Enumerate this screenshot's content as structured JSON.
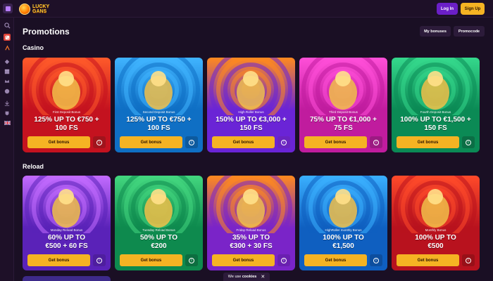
{
  "header": {
    "logo_text": "LUCKY GANS",
    "login_label": "Log In",
    "signup_label": "Sign Up"
  },
  "sidebar": {
    "icons": [
      "search-icon",
      "casino-icon",
      "sports-icon",
      "cards-icon",
      "promo-icon",
      "vip-icon",
      "gift-icon",
      "download-icon",
      "support-icon",
      "language-flag-icon"
    ]
  },
  "page": {
    "title": "Promotions",
    "my_bonuses_label": "My bonuses",
    "promocode_label": "Promocode"
  },
  "sections": {
    "casino": {
      "title": "Casino",
      "cards": [
        {
          "label": "First Deposit Bonus",
          "line1": "125% UP TO €750 +",
          "line2": "100 FS",
          "button": "Get bonus",
          "bg": "#c4121f",
          "bg2": "#ff5a2a",
          "info": "#a0141c"
        },
        {
          "label": "Second Deposit Bonus",
          "line1": "125% UP TO €750 +",
          "line2": "100 FS",
          "button": "Get bonus",
          "bg": "#0f6fc4",
          "bg2": "#40b4ff",
          "info": "#0d5a9e"
        },
        {
          "label": "High Roller Bonus",
          "line1": "150% UP TO €3,000 +",
          "line2": "150 FS",
          "button": "Get bonus",
          "bg": "#6a24d6",
          "bg2": "#ff8a1e",
          "info": "#6a24c0"
        },
        {
          "label": "Third Deposit Bonus",
          "line1": "75% UP TO €1,000 +",
          "line2": "75 FS",
          "button": "Get bonus",
          "bg": "#c01c9e",
          "bg2": "#ff4fd8",
          "info": "#9c1a82"
        },
        {
          "label": "Fourth Deposit Bonus",
          "line1": "100% UP TO €1,500 +",
          "line2": "150 FS",
          "button": "Get bonus",
          "bg": "#0b8a55",
          "bg2": "#35d88c",
          "info": "#0b6e45"
        }
      ]
    },
    "reload": {
      "title": "Reload",
      "cards": [
        {
          "label": "Monday Reload Bonus",
          "line1": "60% UP TO",
          "line2": "€500 + 60 FS",
          "button": "Get bonus",
          "bg": "#5a22b8",
          "bg2": "#c36bff",
          "info": "#4e1e9e"
        },
        {
          "label": "Tuesday Reload Bonus",
          "line1": "50% UP TO",
          "line2": "€200",
          "button": "Get bonus",
          "bg": "#0e8a4e",
          "bg2": "#43d77f",
          "info": "#0d6e40"
        },
        {
          "label": "Friday Reload Bonus",
          "line1": "35% UP TO",
          "line2": "€300 + 30 FS",
          "button": "Get bonus",
          "bg": "#7a24c8",
          "bg2": "#ff8a1e",
          "info": "#6a20b0"
        },
        {
          "label": "HighRoller monthly Bonus",
          "line1": "100% UP TO",
          "line2": "€1,500",
          "button": "Get bonus",
          "bg": "#0f5fc0",
          "bg2": "#3ab0ff",
          "info": "#0d4e9e"
        },
        {
          "label": "Monthly Bonus",
          "line1": "100% UP TO",
          "line2": "€500",
          "button": "Get bonus",
          "bg": "#b8121e",
          "bg2": "#ff4a2a",
          "info": "#981018"
        }
      ]
    }
  },
  "cookie": {
    "prefix": "We use",
    "bold": "cookies",
    "close": "✕"
  }
}
